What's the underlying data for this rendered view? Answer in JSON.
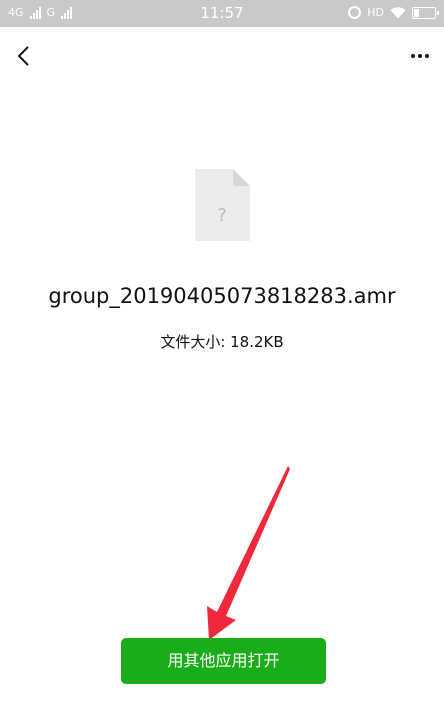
{
  "status_bar": {
    "network_1": "4G",
    "network_2": "G",
    "time": "11:57",
    "hd": "HD",
    "battery_level": 0.25
  },
  "top_bar": {
    "back_icon": "chevron-left-icon",
    "more_icon": "more-horizontal-icon"
  },
  "file": {
    "icon": "unknown-file-icon",
    "icon_glyph": "?",
    "name": "group_20190405073818283.amr",
    "size_text": "文件大小: 18.2KB"
  },
  "actions": {
    "open_with_label": "用其他应用打开",
    "accent_color": "#1aad19"
  },
  "annotation": {
    "arrow_color": "#f0283c"
  }
}
